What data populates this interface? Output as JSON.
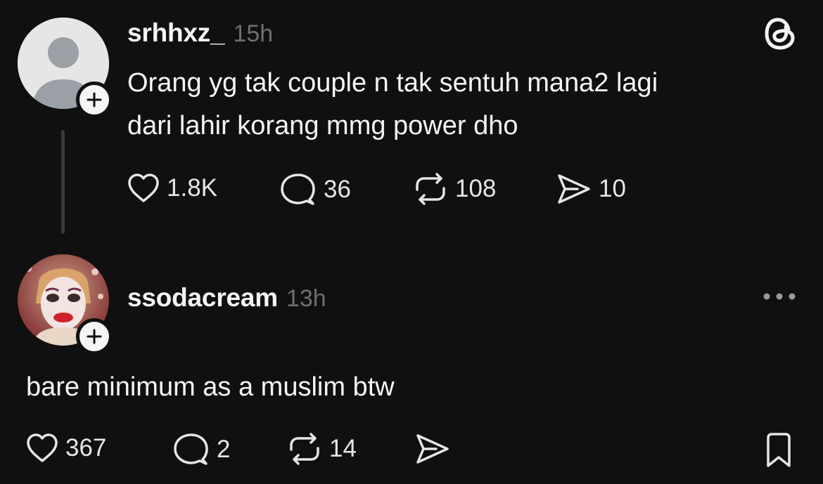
{
  "post": {
    "username": "srhhxz_",
    "time": "15h",
    "text_lines": [
      "Orang yg tak couple n tak sentuh mana2 lagi",
      "dari lahir korang mmg power dho"
    ],
    "likes": "1.8K",
    "replies": "36",
    "reposts": "108",
    "shares": "10"
  },
  "reply": {
    "username": "ssodacream",
    "time": "13h",
    "text": "bare minimum as a muslim btw",
    "likes": "367",
    "replies": "2",
    "reposts": "14"
  },
  "icons": {
    "app_logo": "threads-logo-icon",
    "more": "more-options-icon",
    "like": "heart-icon",
    "reply": "comment-icon",
    "repost": "repost-icon",
    "share": "share-icon",
    "bookmark": "bookmark-icon",
    "follow": "plus-icon"
  },
  "colors": {
    "background": "#101010",
    "text_primary": "#f3f5f7",
    "text_secondary": "#6f6f6f",
    "thread_line": "#3a3a3a"
  }
}
